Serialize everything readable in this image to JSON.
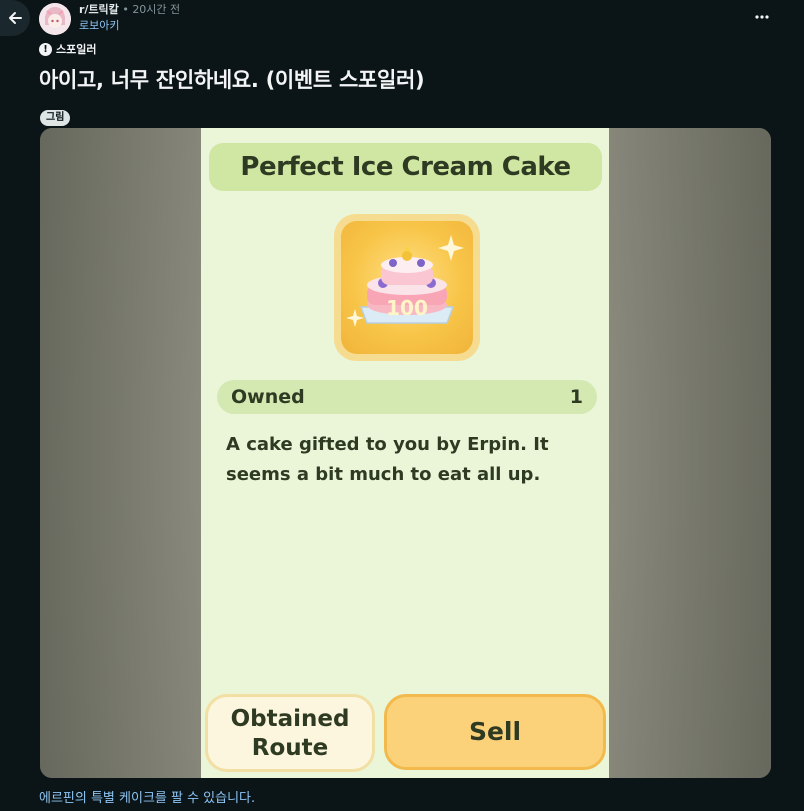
{
  "post": {
    "subreddit": "r/트릭칼",
    "separator": "•",
    "time": "20시간 전",
    "author": "로보아키",
    "spoiler_label": "스포일러",
    "title": "아이고, 너무 잔인하네요. (이벤트 스포일러)",
    "media_badge": "그림",
    "caption": "에르핀의 특별 케이크를 팔 수 있습니다."
  },
  "game": {
    "item_name": "Perfect Ice Cream Cake",
    "cake_number": "100",
    "owned_label": "Owned",
    "owned_count": "1",
    "description": "A cake gifted to you by Erpin. It seems a bit much to eat all up.",
    "route_button": "Obtained Route",
    "sell_button": "Sell"
  },
  "icons": {
    "back": "arrow-left-icon",
    "more": "more-horizontal-icon",
    "spoiler": "alert-icon"
  },
  "colors": {
    "background": "#0b1416",
    "link": "#8ec5f5",
    "game_panel": "#ebf6d9",
    "title_bar": "#cfe7a3",
    "sell_button": "#fbd27a"
  }
}
